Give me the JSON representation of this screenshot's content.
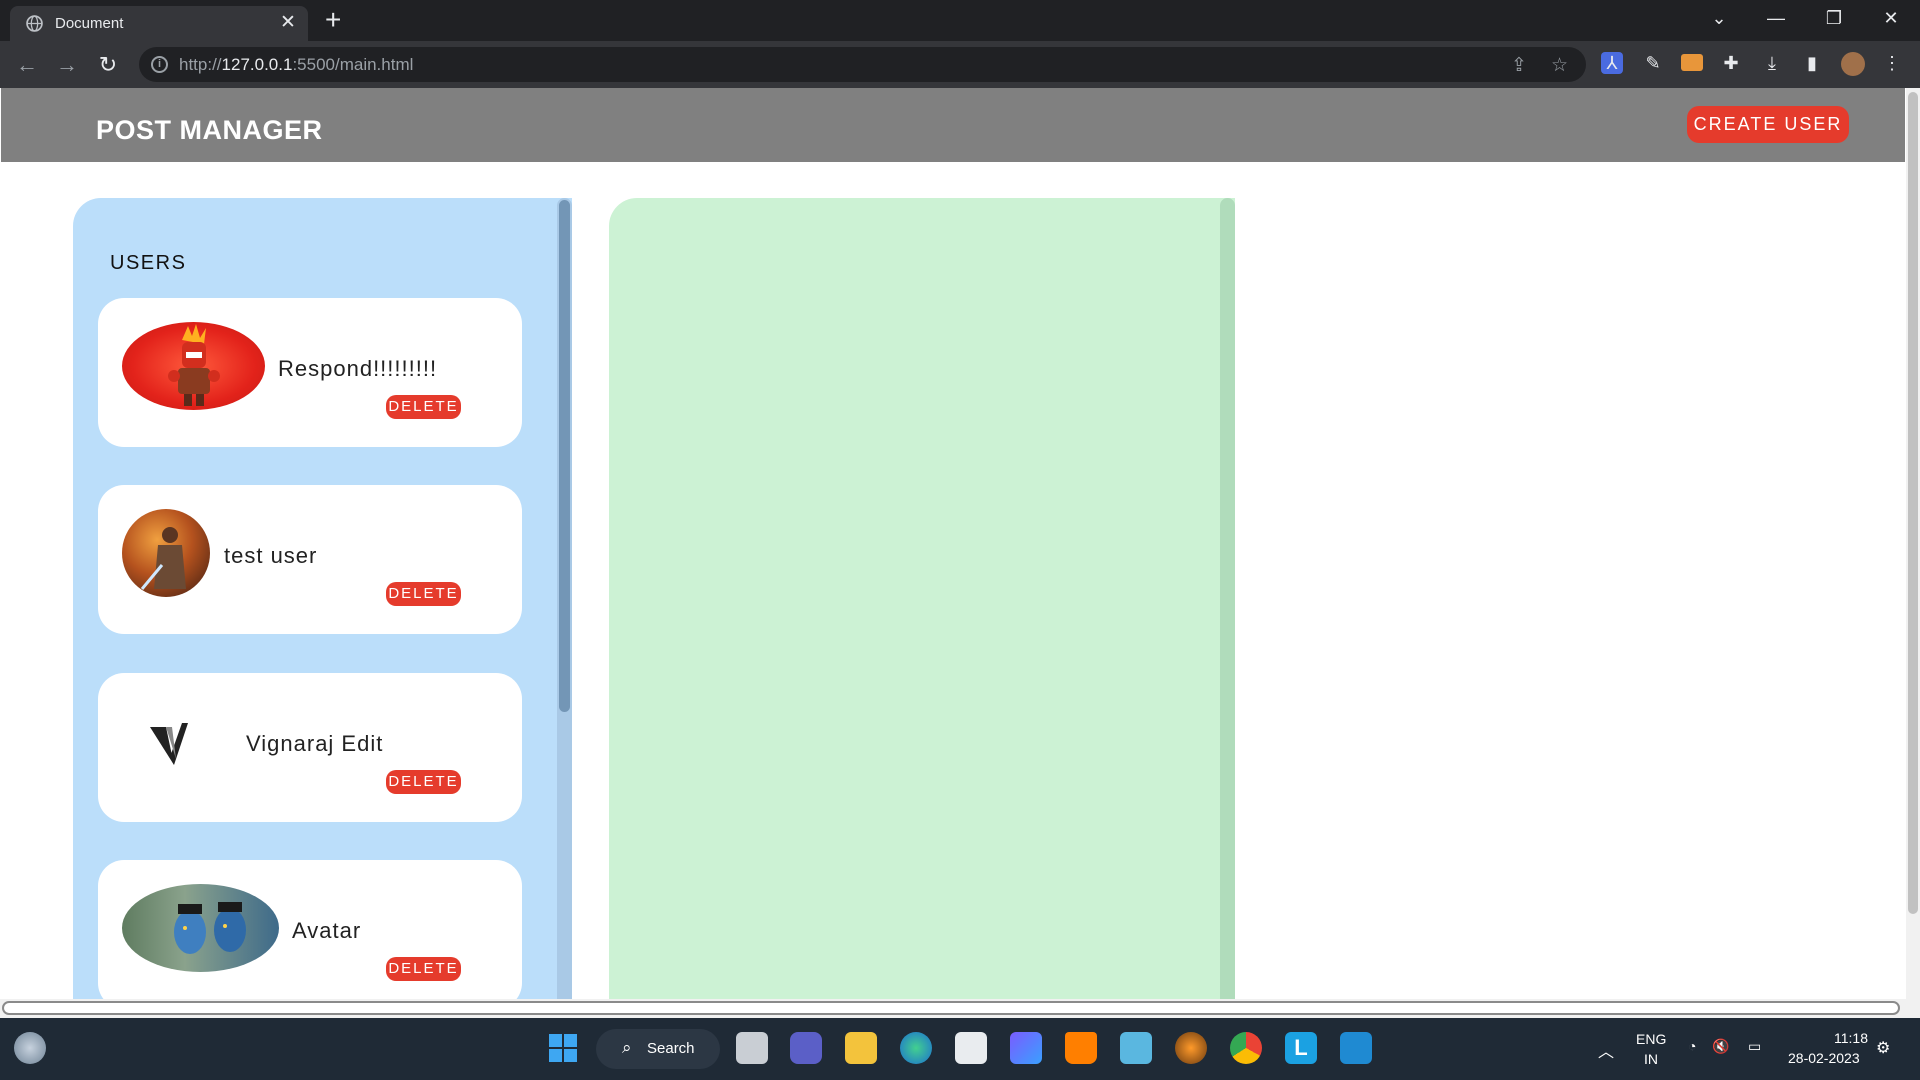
{
  "browser": {
    "tab_title": "Document",
    "tab_close": "✕",
    "new_tab": "+",
    "url_prefix": "http://",
    "url_host": "127.0.0.1",
    "url_rest": ":5500/main.html",
    "icons": [
      "globe-icon",
      "back-icon",
      "forward-icon",
      "reload-icon",
      "info-icon",
      "share-icon",
      "star-icon",
      "extensions-icon",
      "download-icon",
      "sidebar-icon",
      "profile-avatar",
      "menu-icon"
    ]
  },
  "app": {
    "title": "POST MANAGER",
    "create_button": "CREATE USER",
    "users_heading": "USERS",
    "users": [
      {
        "name": "Respond!!!!!!!!!",
        "delete_label": "DELETE",
        "avatar": "anger-character-avatar"
      },
      {
        "name": "test user",
        "delete_label": "DELETE",
        "avatar": "jedi-avatar"
      },
      {
        "name": "Vignaraj Edit",
        "delete_label": "DELETE",
        "avatar": "v-logo-avatar"
      },
      {
        "name": "Avatar",
        "delete_label": "DELETE",
        "avatar": "navi-avatar"
      }
    ]
  },
  "taskbar": {
    "search_label": "Search",
    "lang_top": "ENG",
    "lang_bottom": "IN",
    "time": "11:18",
    "date": "28-02-2023"
  },
  "colors": {
    "header_bg": "#808080",
    "accent_red": "#e53b2c",
    "users_panel": "#bbdefa",
    "posts_panel": "#ccf2d4"
  }
}
